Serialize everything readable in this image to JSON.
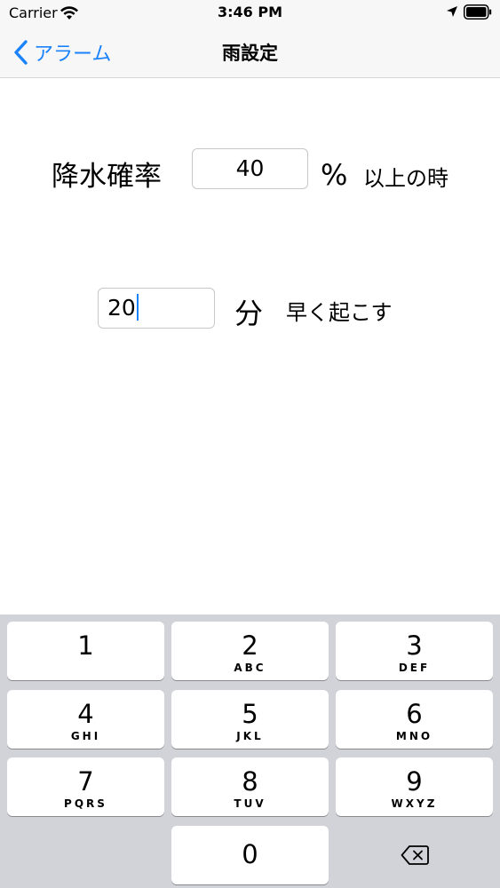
{
  "status_bar": {
    "carrier": "Carrier",
    "time": "3:46 PM"
  },
  "nav": {
    "back_label": "アラーム",
    "title": "雨設定"
  },
  "rain_condition": {
    "label": "降水確率",
    "value": "40",
    "unit": "%",
    "suffix": "以上の時"
  },
  "wake_offset": {
    "value": "20",
    "unit": "分",
    "suffix": "早く起こす"
  },
  "keypad": {
    "keys": [
      {
        "num": "1",
        "letters": ""
      },
      {
        "num": "2",
        "letters": "ABC"
      },
      {
        "num": "3",
        "letters": "DEF"
      },
      {
        "num": "4",
        "letters": "GHI"
      },
      {
        "num": "5",
        "letters": "JKL"
      },
      {
        "num": "6",
        "letters": "MNO"
      },
      {
        "num": "7",
        "letters": "PQRS"
      },
      {
        "num": "8",
        "letters": "TUV"
      },
      {
        "num": "9",
        "letters": "WXYZ"
      },
      {
        "num": "0",
        "letters": ""
      }
    ],
    "delete_icon": "backspace-icon"
  },
  "colors": {
    "accent": "#1a82fb",
    "keyboard_bg": "#d1d3d9",
    "bar_bg": "#f7f7f7"
  }
}
